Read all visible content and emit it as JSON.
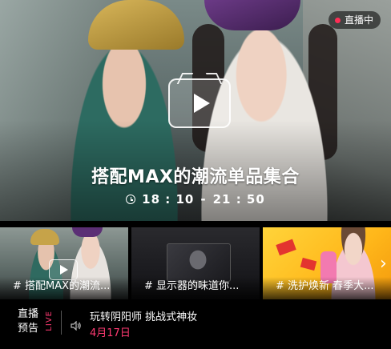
{
  "hero": {
    "live_badge": "直播中",
    "title": "搭配MAX的潮流单品集合",
    "time_start": "18 : 10",
    "time_sep": "-",
    "time_end": "21 : 50"
  },
  "thumbnails": [
    {
      "label": "# 搭配MAX的潮流..."
    },
    {
      "label": "# 显示器的味道你..."
    },
    {
      "label": "# 洗护焕新 春季大..."
    }
  ],
  "bottom": {
    "label_line1": "直播",
    "label_line2": "预告",
    "live_vertical": "LIVE",
    "preview_title": "玩转阴阳师 挑战式神妆",
    "preview_date": "4月17日"
  },
  "colors": {
    "accent_pink": "#ff3a72",
    "live_dot": "#ff2d55"
  }
}
